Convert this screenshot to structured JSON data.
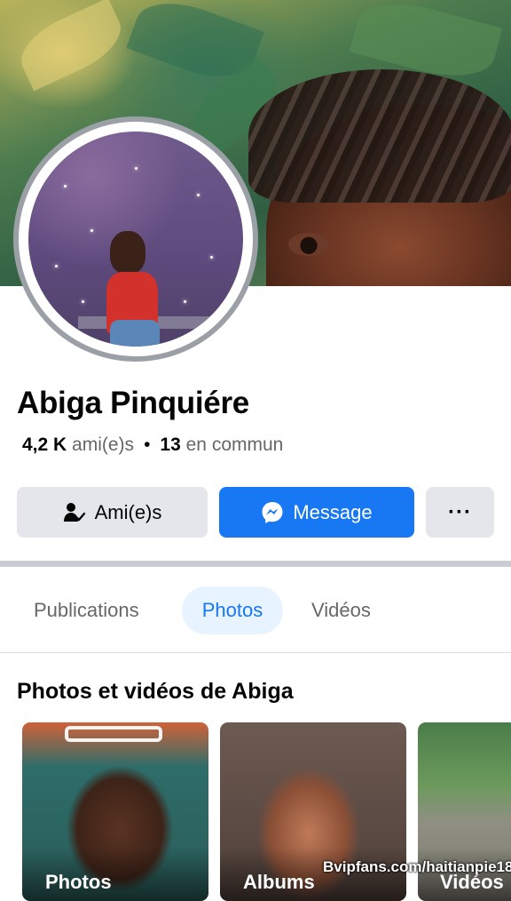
{
  "profile": {
    "name": "Abiga Pinquiére",
    "friends_count": "4,2 K",
    "friends_label": "ami(e)s",
    "mutual_count": "13",
    "mutual_label": "en commun"
  },
  "actions": {
    "friends_label": "Ami(e)s",
    "message_label": "Message",
    "more_label": "···"
  },
  "tabs": [
    {
      "label": "Publications",
      "active": false
    },
    {
      "label": "Photos",
      "active": true
    },
    {
      "label": "Vidéos",
      "active": false
    }
  ],
  "media_section": {
    "title": "Photos et vidéos de Abiga",
    "tiles": [
      {
        "label": "Photos"
      },
      {
        "label": "Albums"
      },
      {
        "label": "Vidéos"
      }
    ]
  },
  "watermark": "Bvipfans.com/haitianpie18",
  "colors": {
    "accent": "#1877f2",
    "button_gray": "#e4e6eb",
    "secondary_text": "#65676b",
    "active_tab_bg": "#e7f3ff"
  },
  "icons": {
    "friends": "person-check-icon",
    "message": "messenger-icon",
    "more": "more-dots-icon"
  }
}
